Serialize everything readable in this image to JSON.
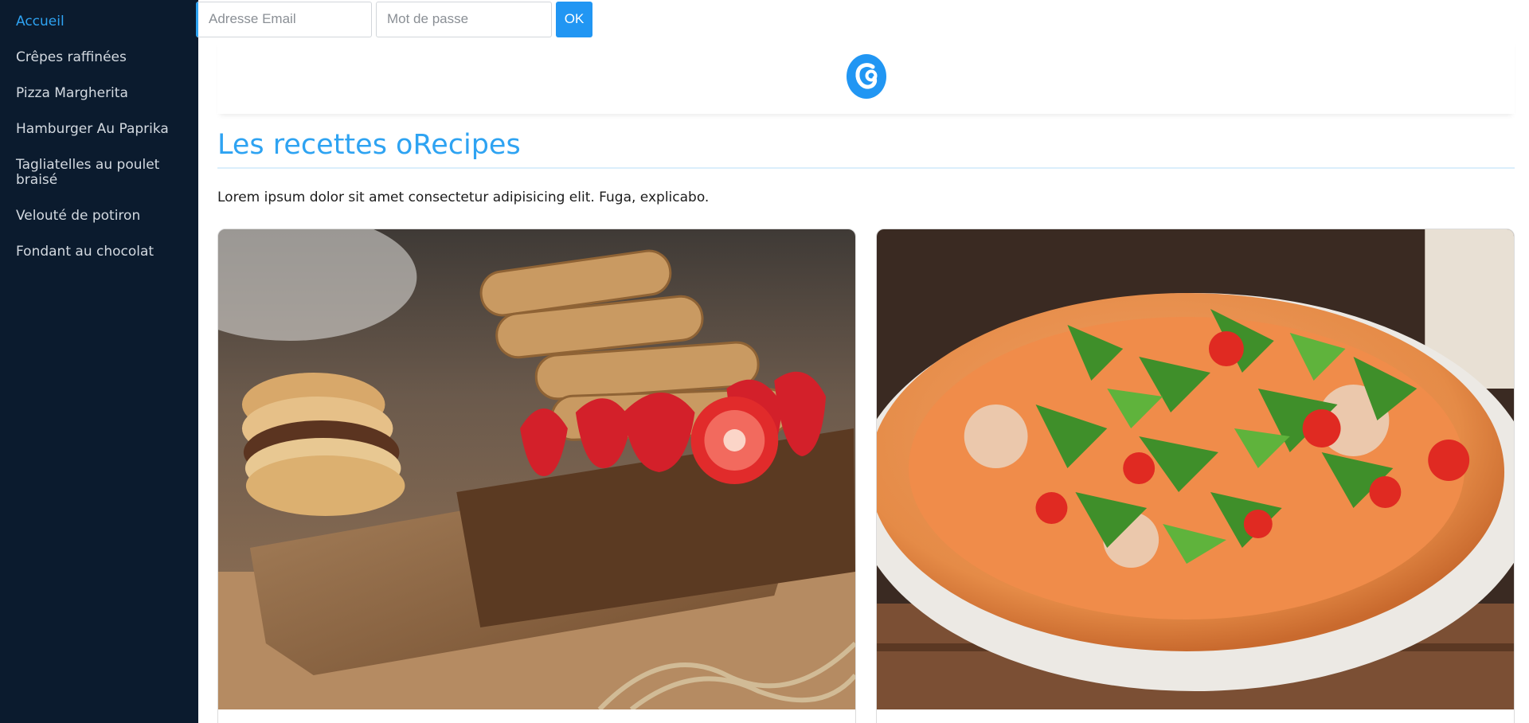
{
  "sidebar": {
    "items": [
      {
        "label": "Accueil",
        "active": true
      },
      {
        "label": "Crêpes raffinées"
      },
      {
        "label": "Pizza Margherita"
      },
      {
        "label": "Hamburger Au Paprika"
      },
      {
        "label": "Tagliatelles au poulet braisé"
      },
      {
        "label": "Velouté de potiron"
      },
      {
        "label": "Fondant au chocolat"
      }
    ]
  },
  "login": {
    "email_placeholder": "Adresse Email",
    "password_placeholder": "Mot de passe",
    "submit_label": "OK"
  },
  "header": {
    "logo_icon": "orecipes-logo-icon"
  },
  "main": {
    "title": "Les recettes oRecipes",
    "intro": "Lorem ipsum dolor sit amet consectetur adipisicing elit. Fuga, explicabo."
  },
  "cards": [
    {
      "image_icon": "crepes-photo-icon"
    },
    {
      "image_icon": "pizza-photo-icon"
    }
  ],
  "colors": {
    "accent": "#2ea3f2",
    "button": "#2196f3",
    "sidebar_bg": "#0b1b2e",
    "sidebar_text": "#d3d9e0"
  }
}
